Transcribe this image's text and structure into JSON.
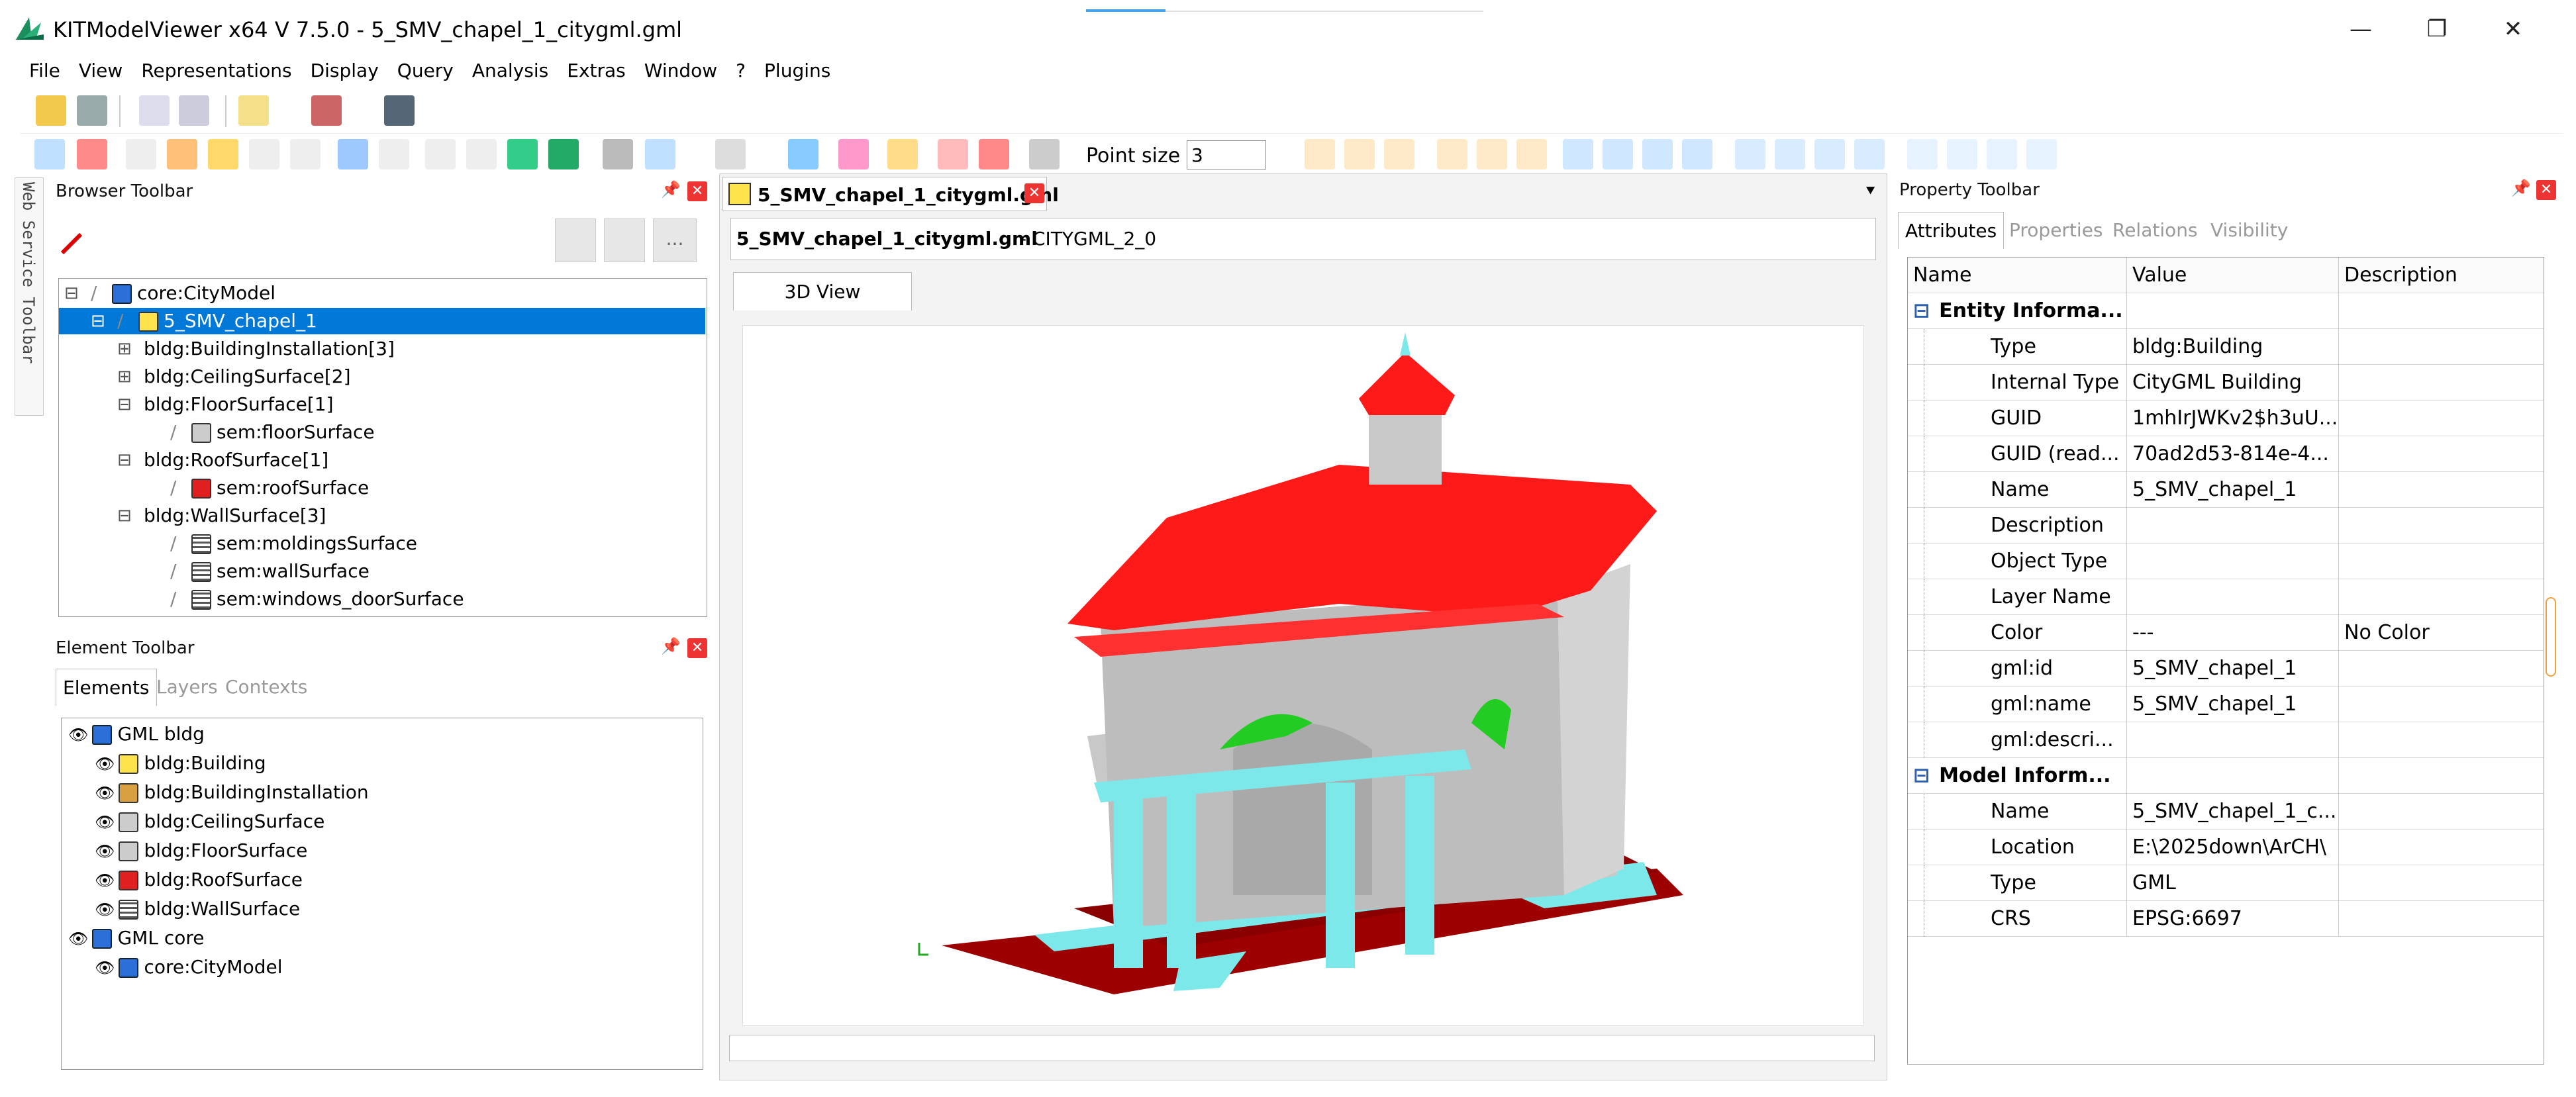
{
  "window": {
    "title": "KITModelViewer x64 V 7.5.0 - 5_SMV_chapel_1_citygml.gml",
    "controls": [
      "—",
      "❐",
      "✕"
    ]
  },
  "menu": [
    "File",
    "View",
    "Representations",
    "Display",
    "Query",
    "Analysis",
    "Extras",
    "Window",
    "?",
    "Plugins"
  ],
  "toolbar": {
    "point_size_label": "Point size",
    "point_size_value": "3"
  },
  "side_tab": "Web Service Toolbar",
  "browser": {
    "title": "Browser Toolbar",
    "ellipsis": "...",
    "tree": [
      {
        "label": "core:CityModel",
        "level": 0,
        "toggle": "⊟",
        "icon": "blue"
      },
      {
        "label": "5_SMV_chapel_1",
        "level": 1,
        "toggle": "⊟",
        "icon": "yellow",
        "selected": true
      },
      {
        "label": "bldg:BuildingInstallation[3]",
        "level": 2,
        "toggle": "⊞"
      },
      {
        "label": "bldg:CeilingSurface[2]",
        "level": 2,
        "toggle": "⊞"
      },
      {
        "label": "bldg:FloorSurface[1]",
        "level": 2,
        "toggle": "⊟"
      },
      {
        "label": "sem:floorSurface",
        "level": 3,
        "icon": "gray"
      },
      {
        "label": "bldg:RoofSurface[1]",
        "level": 2,
        "toggle": "⊟"
      },
      {
        "label": "sem:roofSurface",
        "level": 3,
        "icon": "red"
      },
      {
        "label": "bldg:WallSurface[3]",
        "level": 2,
        "toggle": "⊟"
      },
      {
        "label": "sem:moldingsSurface",
        "level": 3,
        "icon": "wall"
      },
      {
        "label": "sem:wallSurface",
        "level": 3,
        "icon": "wall"
      },
      {
        "label": "sem:windows_doorSurface",
        "level": 3,
        "icon": "wall"
      }
    ]
  },
  "element": {
    "title": "Element Toolbar",
    "tabs": [
      "Elements",
      "Layers",
      "Contexts"
    ],
    "tree": [
      {
        "label": "GML bldg",
        "level": 0,
        "icon": "blue"
      },
      {
        "label": "bldg:Building",
        "level": 1,
        "icon": "yellow"
      },
      {
        "label": "bldg:BuildingInstallation",
        "level": 1,
        "icon": "box"
      },
      {
        "label": "bldg:CeilingSurface",
        "level": 1,
        "icon": "gray"
      },
      {
        "label": "bldg:FloorSurface",
        "level": 1,
        "icon": "gray"
      },
      {
        "label": "bldg:RoofSurface",
        "level": 1,
        "icon": "red"
      },
      {
        "label": "bldg:WallSurface",
        "level": 1,
        "icon": "wall"
      },
      {
        "label": "GML core",
        "level": 0,
        "icon": "blue"
      },
      {
        "label": "core:CityModel",
        "level": 1,
        "icon": "blue"
      }
    ]
  },
  "document": {
    "tab_label": "5_SMV_chapel_1_citygml.gml",
    "header_file": "5_SMV_chapel_1_citygml.gml",
    "header_rest": " - CITYGML_2_0",
    "view_tab": "3D View"
  },
  "property": {
    "title": "Property Toolbar",
    "tabs": [
      "Attributes",
      "Properties",
      "Relations",
      "Visibility"
    ],
    "columns": [
      "Name",
      "Value",
      "Description"
    ],
    "rows": [
      {
        "group": true,
        "name": "Entity Informa...",
        "value": "",
        "desc": ""
      },
      {
        "name": "Type",
        "value": "bldg:Building",
        "desc": ""
      },
      {
        "name": "Internal Type",
        "value": "CityGML Building",
        "desc": ""
      },
      {
        "name": "GUID",
        "value": "1mhIrJWKv2$h3uU...",
        "desc": ""
      },
      {
        "name": "GUID (read...",
        "value": "70ad2d53-814e-4...",
        "desc": ""
      },
      {
        "name": "Name",
        "value": "5_SMV_chapel_1",
        "desc": ""
      },
      {
        "name": "Description",
        "value": "",
        "desc": ""
      },
      {
        "name": "Object Type",
        "value": "",
        "desc": ""
      },
      {
        "name": "Layer Name",
        "value": "",
        "desc": ""
      },
      {
        "name": "Color",
        "value": "---",
        "desc": "No Color"
      },
      {
        "name": "gml:id",
        "value": "5_SMV_chapel_1",
        "desc": ""
      },
      {
        "name": "gml:name",
        "value": "5_SMV_chapel_1",
        "desc": ""
      },
      {
        "name": "gml:descri...",
        "value": "",
        "desc": ""
      },
      {
        "group": true,
        "name": "Model Inform...",
        "value": "",
        "desc": ""
      },
      {
        "name": "Name",
        "value": "5_SMV_chapel_1_c...",
        "desc": ""
      },
      {
        "name": "Location",
        "value": "E:\\2025down\\ArCH\\",
        "desc": ""
      },
      {
        "name": "Type",
        "value": "GML",
        "desc": ""
      },
      {
        "name": "CRS",
        "value": "EPSG:6697",
        "desc": ""
      }
    ]
  },
  "colors": {
    "selection": "#0078d7",
    "roof": "#ff1a1a",
    "wall": "#c8c8c8",
    "columns": "#7de8ea",
    "ground": "#9c0000",
    "accent_green": "#22cc22"
  }
}
